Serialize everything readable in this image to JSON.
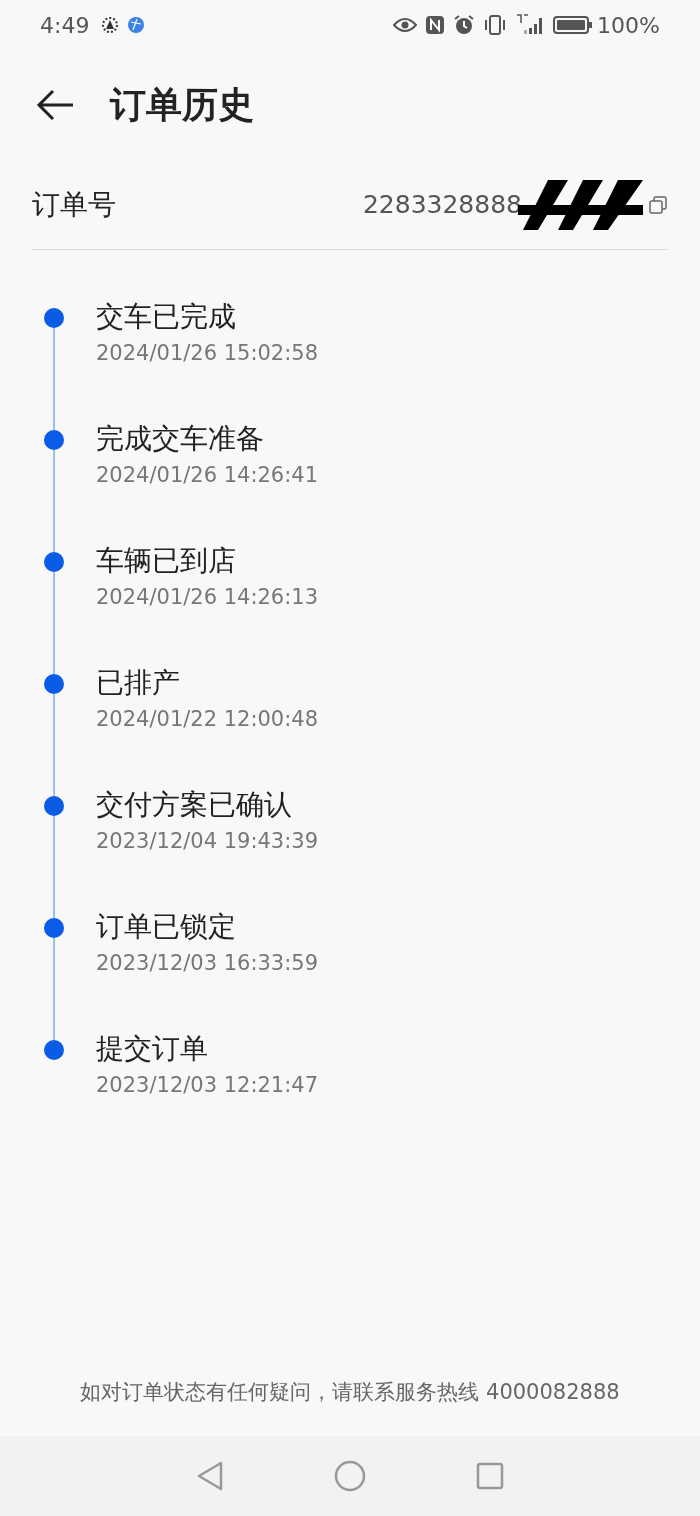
{
  "status_bar": {
    "time": "4:49",
    "battery": "100%"
  },
  "header": {
    "title": "订单历史"
  },
  "order": {
    "label": "订单号",
    "number": "2283328888"
  },
  "timeline": [
    {
      "title": "交车已完成",
      "time": "2024/01/26 15:02:58"
    },
    {
      "title": "完成交车准备",
      "time": "2024/01/26 14:26:41"
    },
    {
      "title": "车辆已到店",
      "time": "2024/01/26 14:26:13"
    },
    {
      "title": "已排产",
      "time": "2024/01/22 12:00:48"
    },
    {
      "title": "交付方案已确认",
      "time": "2023/12/04 19:43:39"
    },
    {
      "title": "订单已锁定",
      "time": "2023/12/03 16:33:59"
    },
    {
      "title": "提交订单",
      "time": "2023/12/03 12:21:47"
    }
  ],
  "footer": {
    "note": "如对订单状态有任何疑问，请联系服务热线 4000082888"
  }
}
